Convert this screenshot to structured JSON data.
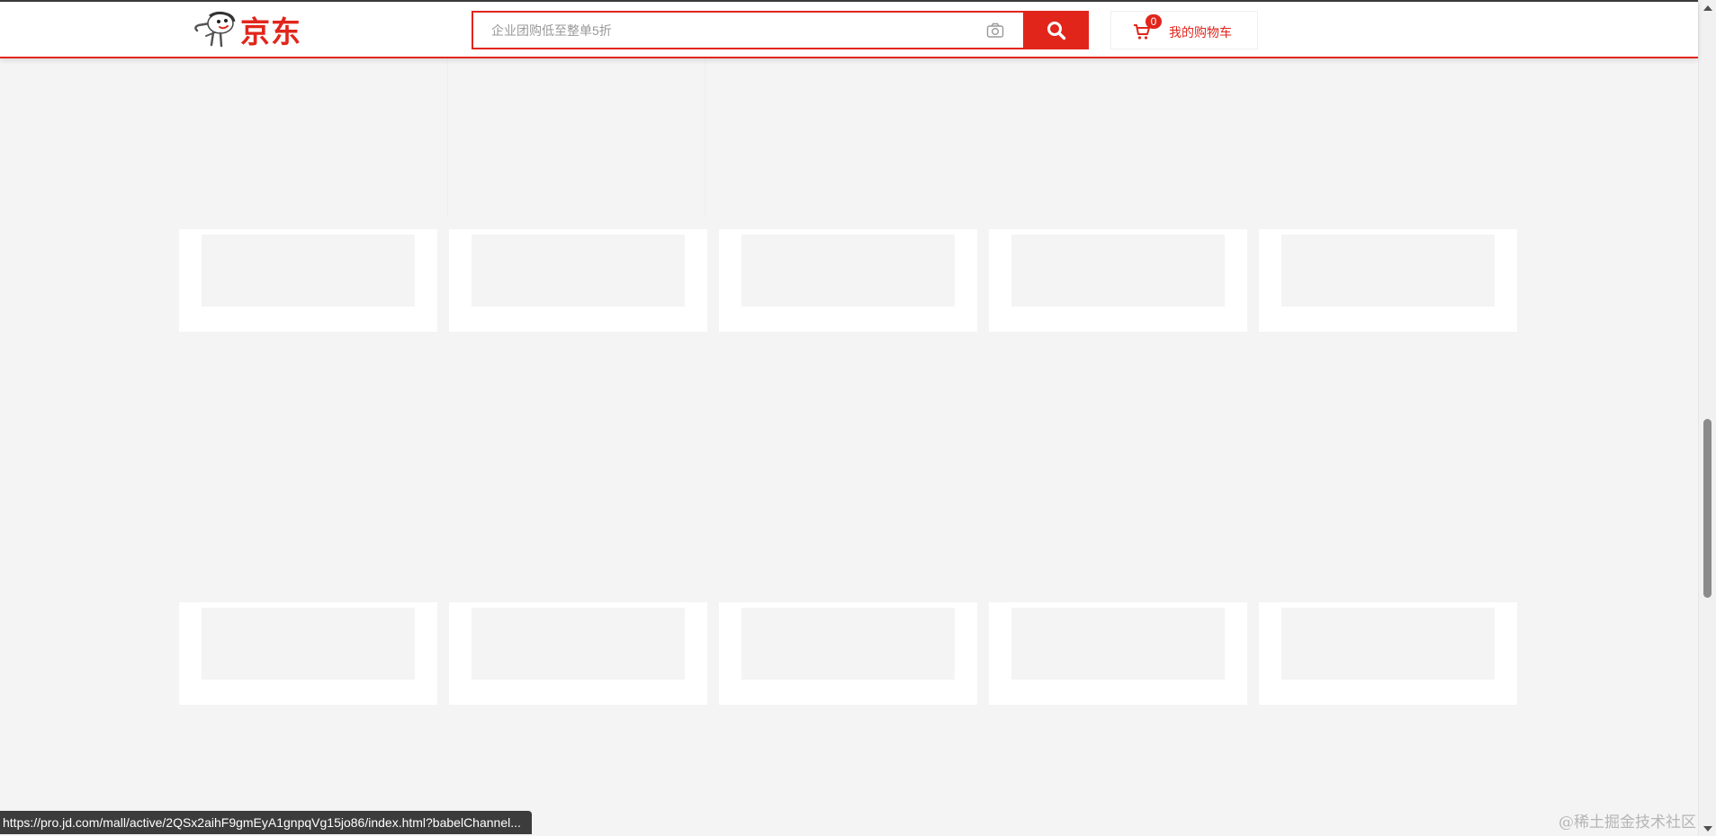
{
  "header": {
    "logo_text": "京东",
    "search": {
      "placeholder": "企业团购低至整单5折"
    },
    "cart": {
      "count": "0",
      "label": "我的购物车"
    }
  },
  "status_bar": {
    "url": "https://pro.jd.com/mall/active/2QSx2aihF9gmEyA1gnpqVg15jo86/index.html?babelChannel..."
  },
  "watermark": "@稀土掘金技术社区",
  "colors": {
    "brand_red": "#e1251b",
    "page_bg": "#f4f4f4",
    "card_bg": "#ffffff",
    "status_bg": "#3c3c3c"
  },
  "icons": {
    "logo": "jd-dog-logo-icon",
    "camera": "camera-icon",
    "search": "search-icon",
    "cart": "shopping-cart-icon",
    "scroll_up": "scroll-up-arrow-icon",
    "scroll_down": "scroll-down-arrow-icon"
  },
  "placeholder_rows": [
    {
      "cards": 5
    },
    {
      "cards": 5
    }
  ]
}
